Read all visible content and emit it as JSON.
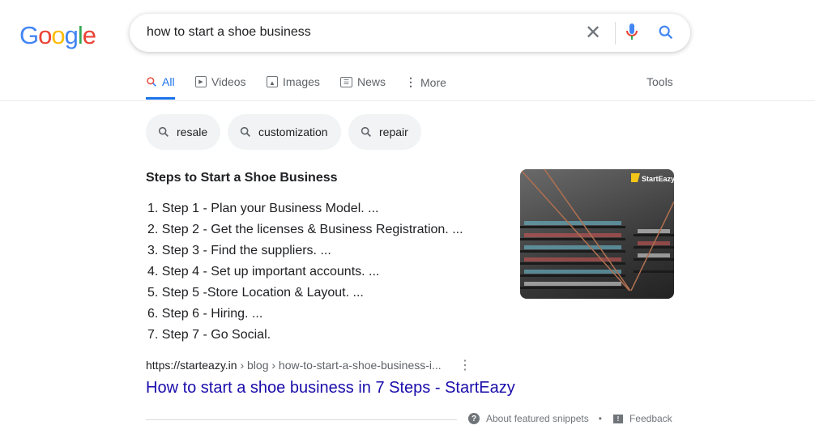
{
  "logo": "Google",
  "search": {
    "query": "how to start a shoe business"
  },
  "tabs": [
    {
      "label": "All",
      "icon": "search-icon"
    },
    {
      "label": "Videos",
      "icon": "play-icon"
    },
    {
      "label": "Images",
      "icon": "image-icon"
    },
    {
      "label": "News",
      "icon": "news-icon"
    },
    {
      "label": "More",
      "icon": "more-vert-icon"
    }
  ],
  "tools": "Tools",
  "chips": [
    "resale",
    "customization",
    "repair"
  ],
  "snippet": {
    "title": "Steps to Start a Shoe Business",
    "steps": [
      "1. Step 1 - Plan your Business Model. ...",
      "2. Step 2 - Get the licenses & Business Registration. ...",
      "3. Step 3 - Find the suppliers. ...",
      "4. Step 4 - Set up important accounts. ...",
      "5. Step 5 -Store Location & Layout. ...",
      "6. Step 6 - Hiring. ...",
      "7. Step 7 - Go Social."
    ],
    "image_logo": "StartEazy",
    "cite_domain": "https://starteazy.in",
    "cite_path": " › blog › how-to-start-a-shoe-business-i...",
    "link": "How to start a shoe business in 7 Steps - StartEazy",
    "about": "About featured snippets",
    "dot": "•",
    "feedback": "Feedback"
  },
  "colors": {
    "accent": "#1a73e8",
    "link": "#1a0dab"
  }
}
